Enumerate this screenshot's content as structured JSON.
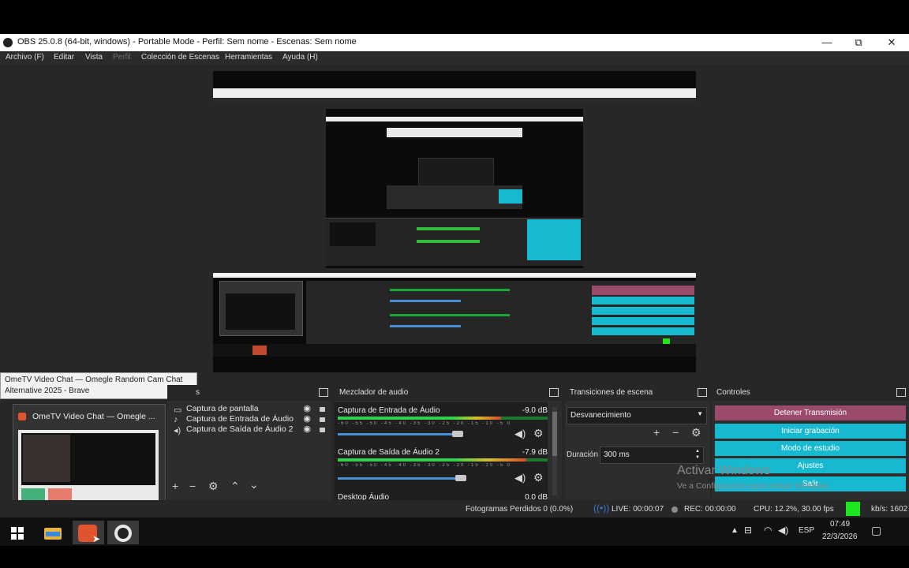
{
  "window": {
    "title": "OBS 25.0.8 (64-bit, windows) - Portable Mode - Perfil: Sem nome - Escenas: Sem nome",
    "minimize": "—",
    "maximize": "⧉",
    "close": "✕"
  },
  "menu": [
    "Archivo (F)",
    "Editar",
    "Vista",
    "Perfil",
    "Colección de Escenas",
    "Herramientas",
    "Ayuda (H)"
  ],
  "tooltip": {
    "line1": "OmeTV Video Chat — Omegle Random Cam Chat",
    "line2": "Alternative 2025 - Brave"
  },
  "thumbnail": {
    "title": "OmeTV Video Chat — Omegle ..."
  },
  "sources": {
    "header_suffix": "s",
    "items": [
      "Captura de pantalla",
      "Captura de Entrada de Áudio",
      "Captura de Saída de Áudio 2"
    ]
  },
  "mixer": {
    "header": "Mezclador de audio",
    "channels": [
      {
        "name": "Captura de Entrada de Áudio",
        "db": "-9.0 dB",
        "level": 0.78,
        "volume": 0.96
      },
      {
        "name": "Captura de Saída de Áudio 2",
        "db": "-7.9 dB",
        "level": 0.9,
        "volume": 0.99
      },
      {
        "name": "Desktop Áudio",
        "db": "0.0 dB"
      }
    ],
    "ticks": "-60 -55 -50 -45 -40 -35 -30 -25 -20 -15 -10 -5 0"
  },
  "transitions": {
    "header": "Transiciones de escena",
    "selected": "Desvanecimiento",
    "duration_label": "Duración",
    "duration_value": "300 ms"
  },
  "controls": {
    "header": "Controles",
    "buttons": [
      "Detener Transmisión",
      "Iniciar grabación",
      "Modo de estudio",
      "Ajustes",
      "Salir"
    ]
  },
  "status": {
    "frames": "Fotogramas Perdidos 0 (0.0%)",
    "live": "LIVE: 00:00:07",
    "rec": "REC: 00:00:00",
    "cpu": "CPU: 12.2%, 30.00 fps",
    "kbps": "kb/s: 1602"
  },
  "watermark": {
    "line1": "Activar Windows",
    "line2": "Ve a Configuración para activar Windows."
  },
  "taskbar": {
    "lang": "ESP",
    "time": "07:49",
    "date": "22/3/2026"
  },
  "colors": {
    "accent": "#17b9d1",
    "stop": "#9c4a6b",
    "live_dot": "#3a7bd5",
    "green_indicator": "#1ee61e"
  }
}
